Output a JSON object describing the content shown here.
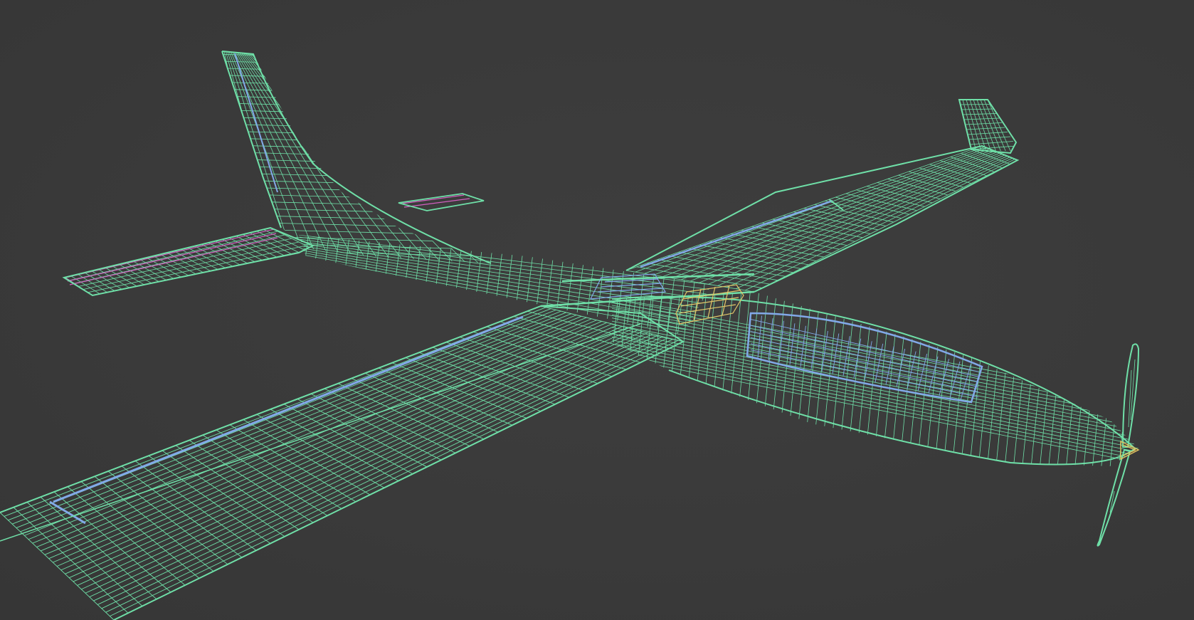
{
  "scene": {
    "subject": "wireframe-glider-model",
    "background_color": "#3a3a3a",
    "colors": {
      "mesh_primary": "#6fe0a8",
      "mesh_secondary": "#82a9e8",
      "control_surface_magenta": "#d35fc0",
      "hatch_yellow": "#e3c86a",
      "spinner_yellow": "#e6c45e",
      "mesh_dark": "#3fa879"
    }
  }
}
